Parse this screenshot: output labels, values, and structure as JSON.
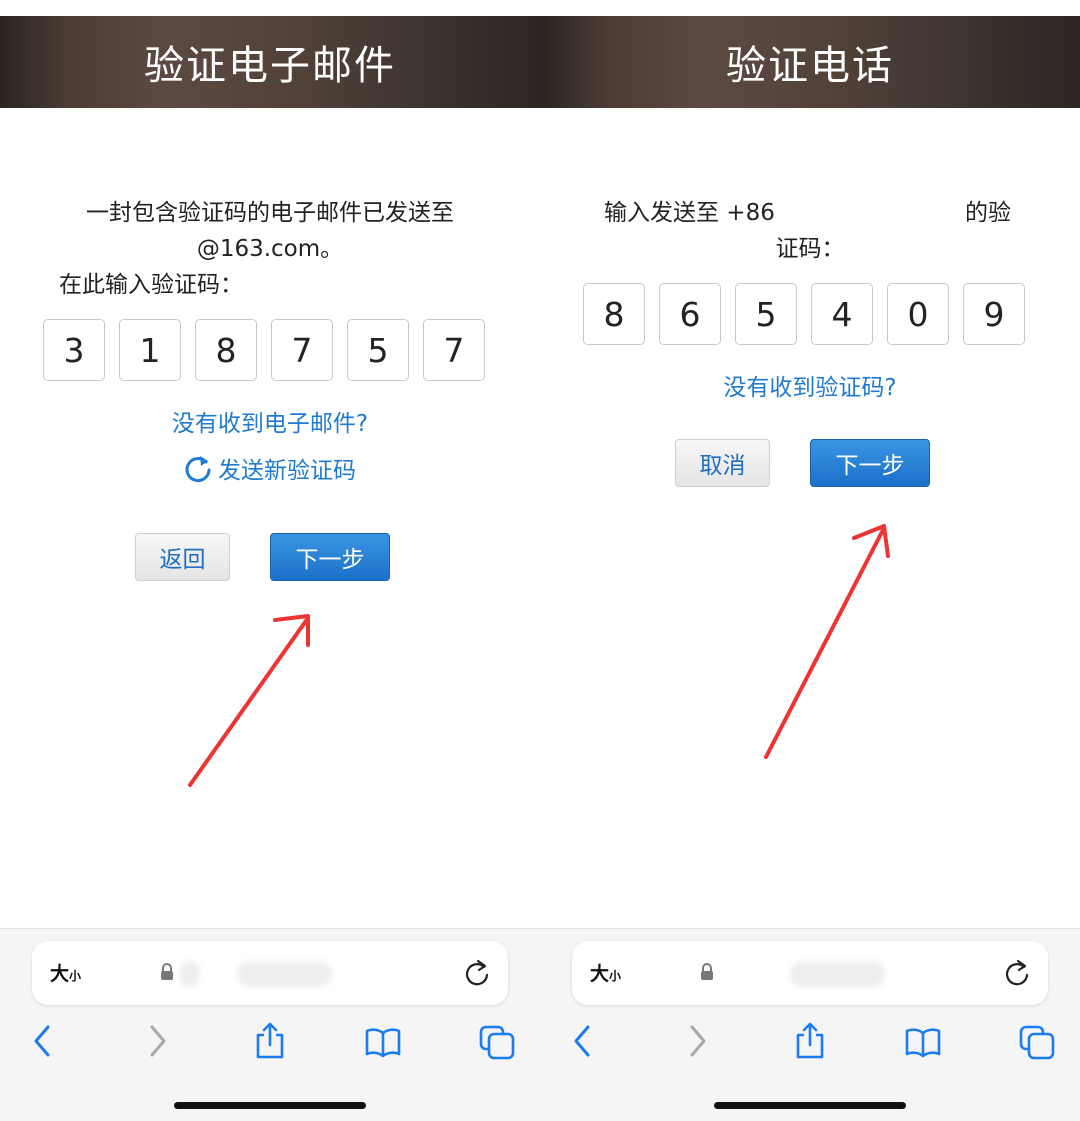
{
  "email_screen": {
    "header_title": "验证电子邮件",
    "message_line1": "一封包含验证码的电子邮件已发送至",
    "message_line2": "@163.com。",
    "prompt": "在此输入验证码：",
    "code_digits": [
      "3",
      "1",
      "8",
      "7",
      "5",
      "7"
    ],
    "no_email_link": "没有收到电子邮件?",
    "resend_link": "发送新验证码",
    "back_button": "返回",
    "next_button": "下一步"
  },
  "phone_screen": {
    "header_title": "验证电话",
    "message_part1": "输入发送至 +86",
    "message_part2": "的验",
    "message_line2": "证码：",
    "code_digits": [
      "8",
      "6",
      "5",
      "4",
      "0",
      "9"
    ],
    "no_code_link": "没有收到验证码?",
    "cancel_button": "取消",
    "next_button": "下一步"
  },
  "browser": {
    "text_size_label": "大",
    "text_size_small": "小"
  },
  "colors": {
    "link": "#1f7bcf",
    "primary_button": "#1b70c8",
    "arrow": "#ee3333"
  }
}
